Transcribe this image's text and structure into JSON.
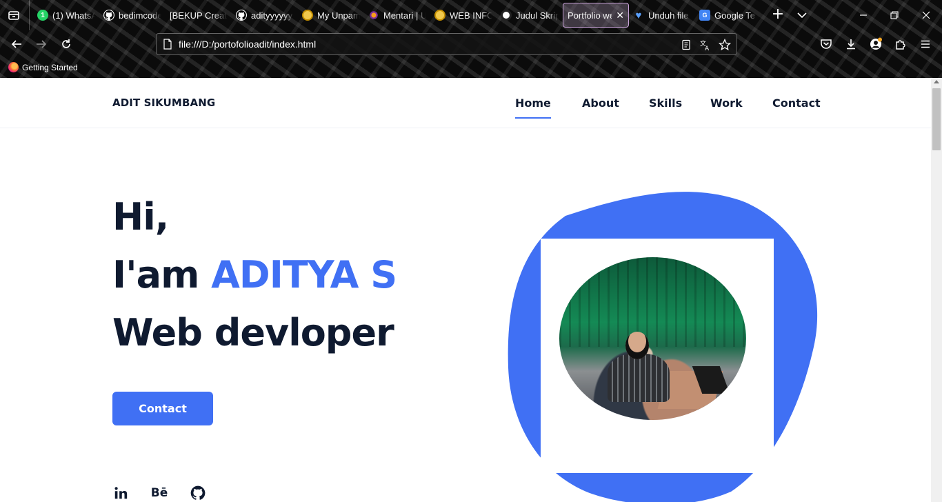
{
  "browser": {
    "tabs": [
      {
        "label": "(1) WhatsApp",
        "favicon": "whatsapp-icon",
        "badge": "1"
      },
      {
        "label": "bedimcode",
        "favicon": "github-icon"
      },
      {
        "label": "[BEKUP Create",
        "favicon": ""
      },
      {
        "label": "adityyyyyy",
        "favicon": "github-icon"
      },
      {
        "label": "My Unpam",
        "favicon": "unpam-icon"
      },
      {
        "label": "Mentari | U",
        "favicon": "mentari-icon"
      },
      {
        "label": "WEB INFO",
        "favicon": "unpam-icon"
      },
      {
        "label": "Judul Skrip",
        "favicon": "chatgpt-icon"
      },
      {
        "label": "Portfolio we",
        "favicon": "",
        "active": true
      },
      {
        "label": "Unduh file",
        "favicon": "heart-icon"
      },
      {
        "label": "Google Te",
        "favicon": "google-translate-icon"
      }
    ],
    "url": "file:///D:/portofolioadit/index.html",
    "bookmarks": [
      {
        "label": "Getting Started",
        "icon": "firefox-icon"
      }
    ]
  },
  "site": {
    "logo": "ADIT SIKUMBANG",
    "nav": [
      "Home",
      "About",
      "Skills",
      "Work",
      "Contact"
    ],
    "active_nav": "Home",
    "accent": "#4070f4",
    "text_color": "#0f1a30",
    "hero": {
      "line1": "Hi,",
      "line2_prefix": "I'am ",
      "name": "ADITYA S",
      "line3": "Web devloper",
      "button": "Contact"
    },
    "social": [
      {
        "icon": "linkedin-icon"
      },
      {
        "icon": "behance-icon",
        "text": "Bē"
      },
      {
        "icon": "github-icon"
      }
    ]
  }
}
